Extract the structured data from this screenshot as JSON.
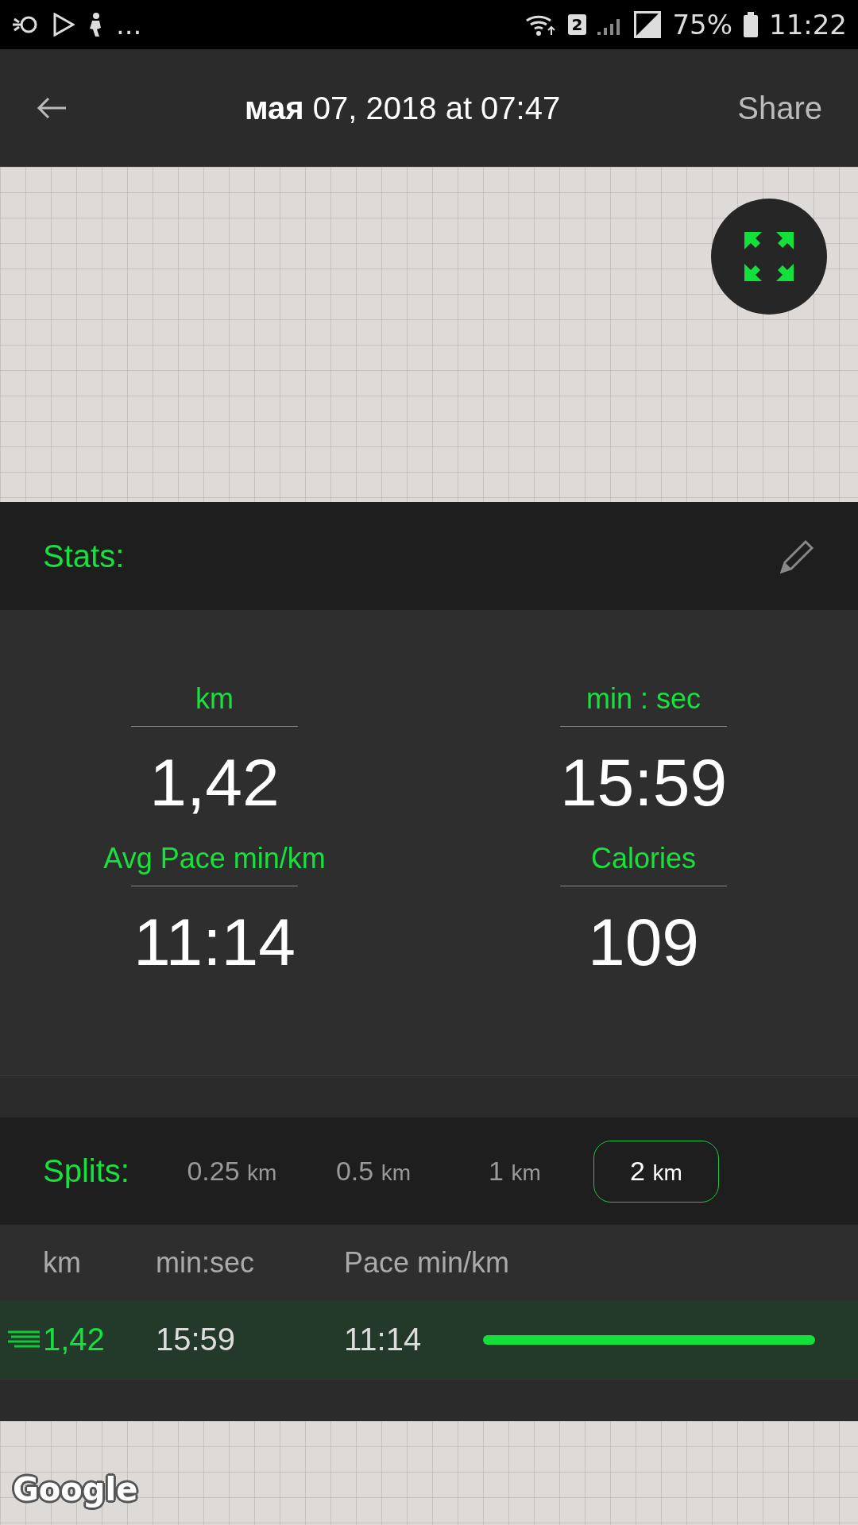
{
  "status_bar": {
    "more": "...",
    "sim_badge": "2",
    "battery": "75%",
    "time": "11:22"
  },
  "header": {
    "title": "**мая** 07, 2018 at 07:47",
    "action": "Share"
  },
  "stats": {
    "title": "Stats:",
    "items": [
      {
        "label": "km",
        "value": "1,42"
      },
      {
        "label": "min : sec",
        "value": "15:59"
      },
      {
        "label": "Avg Pace min/km",
        "value": "11:14"
      },
      {
        "label": "Calories",
        "value": "109"
      }
    ]
  },
  "splits": {
    "title": "Splits:",
    "options": [
      {
        "value": "0.25",
        "unit": "km",
        "selected": false
      },
      {
        "value": "0.5",
        "unit": "km",
        "selected": false
      },
      {
        "value": "1",
        "unit": "km",
        "selected": false
      },
      {
        "value": "2",
        "unit": "km",
        "selected": true
      }
    ],
    "columns": [
      "km",
      "min:sec",
      "Pace min/km"
    ],
    "rows": [
      {
        "km": "1,42",
        "time": "15:59",
        "pace": "11:14"
      }
    ]
  },
  "map_attribution": "Google"
}
